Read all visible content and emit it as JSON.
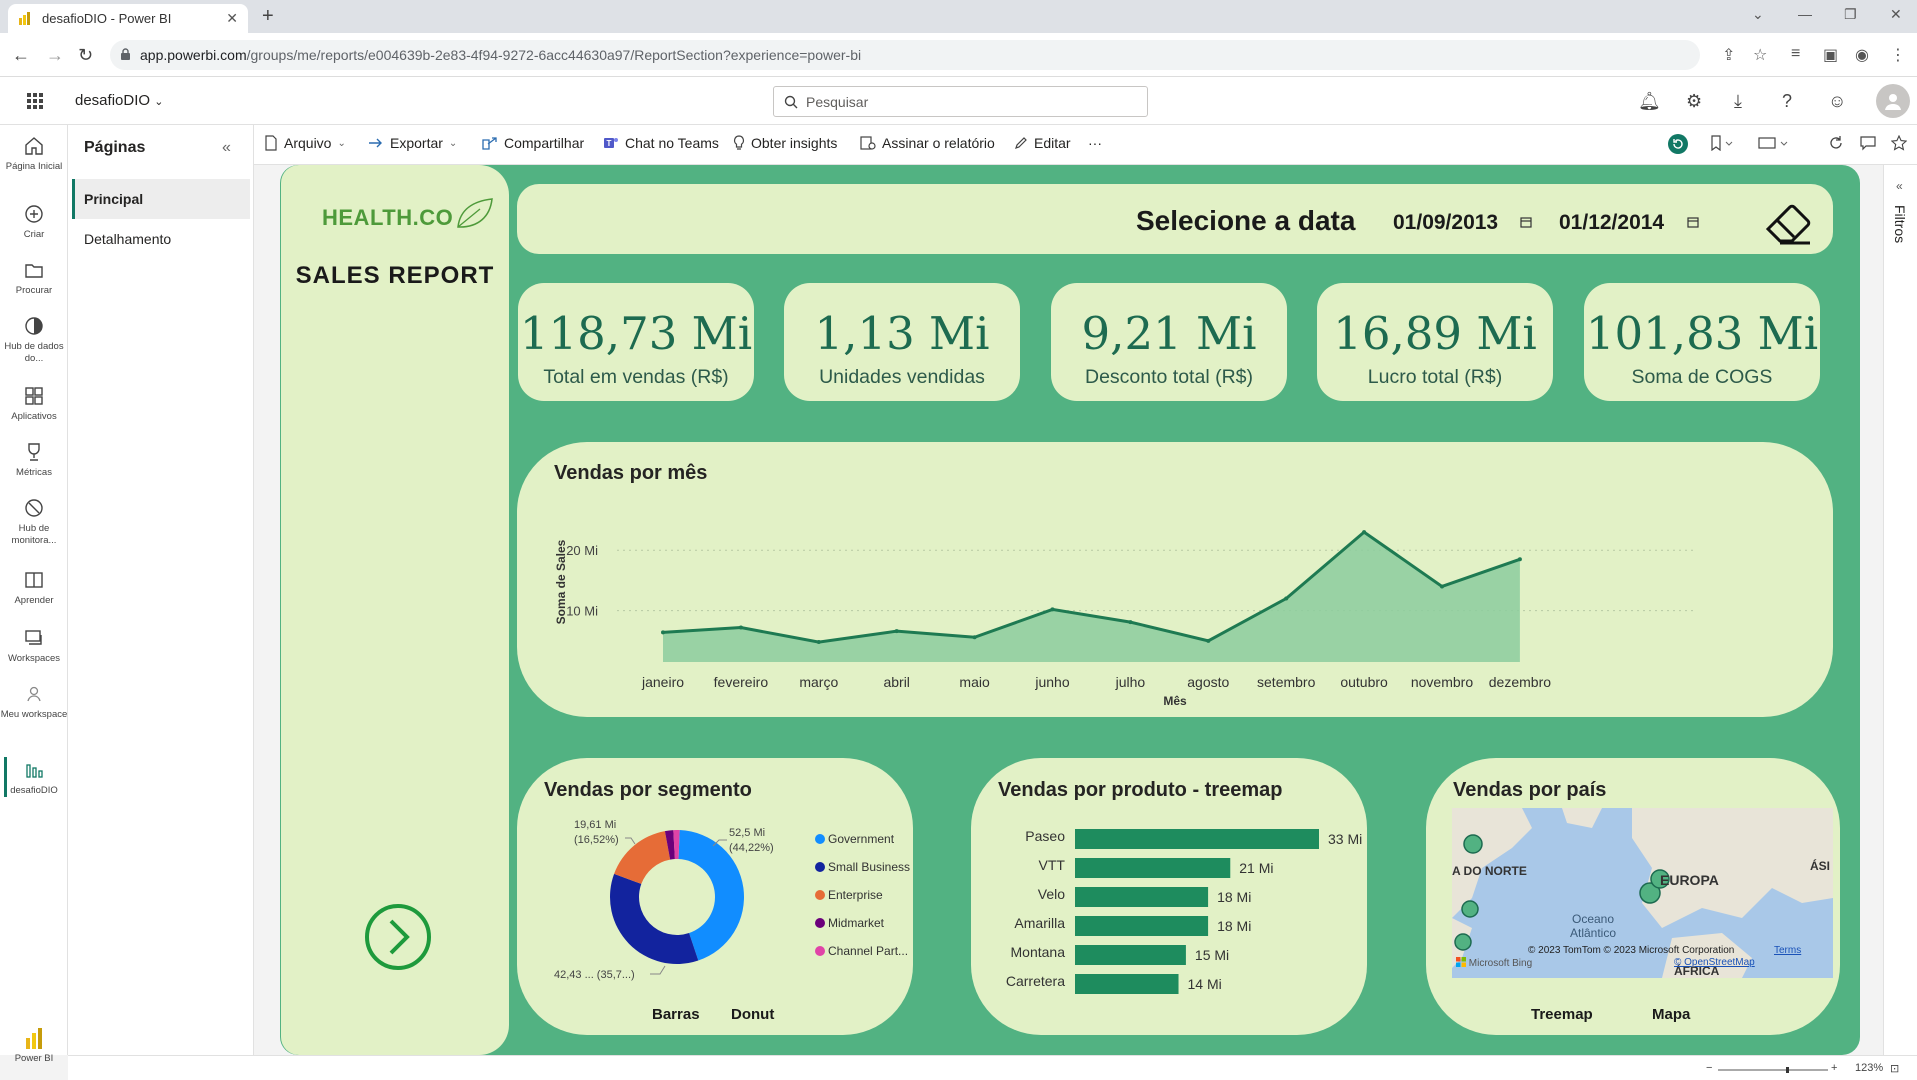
{
  "browser": {
    "tab_title": "desafioDIO - Power BI",
    "url_host": "app.powerbi.com",
    "url_path": "/groups/me/reports/e004639b-2e83-4f94-9272-6acc44630a97/ReportSection?experience=power-bi"
  },
  "topbar": {
    "workspace": "desafioDIO",
    "search_placeholder": "Pesquisar"
  },
  "leftnav": {
    "items": [
      {
        "label": "Página Inicial",
        "icon": "home-icon"
      },
      {
        "label": "Criar",
        "icon": "create-icon"
      },
      {
        "label": "Procurar",
        "icon": "browse-icon"
      },
      {
        "label": "Hub de dados do...",
        "icon": "datahub-icon"
      },
      {
        "label": "Aplicativos",
        "icon": "apps-icon"
      },
      {
        "label": "Métricas",
        "icon": "metrics-icon"
      },
      {
        "label": "Hub de monitora...",
        "icon": "monitoring-icon"
      },
      {
        "label": "Aprender",
        "icon": "learn-icon"
      },
      {
        "label": "Workspaces",
        "icon": "workspaces-icon"
      },
      {
        "label": "Meu workspace",
        "icon": "my-workspace-icon"
      },
      {
        "label": "desafioDIO",
        "icon": "report-icon"
      }
    ],
    "bottom_label": "Power BI"
  },
  "pages_panel": {
    "title": "Páginas",
    "pages": [
      "Principal",
      "Detalhamento"
    ]
  },
  "actions": {
    "arquivo": "Arquivo",
    "exportar": "Exportar",
    "compartilhar": "Compartilhar",
    "chat": "Chat no Teams",
    "insights": "Obter insights",
    "assinar": "Assinar o relatório",
    "editar": "Editar",
    "more": "···"
  },
  "filters_label": "Filtros",
  "report": {
    "brand": "HEALTH.CO",
    "title": "SALES REPORT",
    "date_label": "Selecione a data",
    "date_start": "01/09/2013",
    "date_end": "01/12/2014",
    "kpis": [
      {
        "value": "118,73 Mi",
        "label": "Total em vendas (R$)"
      },
      {
        "value": "1,13 Mi",
        "label": "Unidades vendidas"
      },
      {
        "value": "9,21 Mi",
        "label": "Desconto total (R$)"
      },
      {
        "value": "16,89 Mi",
        "label": "Lucro total (R$)"
      },
      {
        "value": "101,83 Mi",
        "label": "Soma de COGS"
      }
    ],
    "donut_title": "Vendas por segmento",
    "tree_title": "Vendas por produto - treemap",
    "map_title": "Vendas por país",
    "toggle_barras": "Barras",
    "toggle_donut": "Donut",
    "toggle_treemap": "Treemap",
    "toggle_mapa": "Mapa",
    "map_labels": {
      "na": "A DO NORTE",
      "europa": "EUROPA",
      "asia": "ÁSI",
      "ocean": "Oceano Atlântico",
      "africa": "ÁFRICA",
      "copyright": "© 2023 TomTom  © 2023 Microsoft Corporation",
      "terms": "Terms",
      "osm": "© OpenStreetMap",
      "bing": "Microsoft Bing"
    }
  },
  "status": {
    "zoom": "123%"
  },
  "colors": {
    "canvas": "#52b282",
    "card": "#e2f1c6",
    "kpi_text": "#1d6b50",
    "line": "#1e7a52",
    "area": "#8ccc9e",
    "bar": "#1e8c5e"
  },
  "chart_data": [
    {
      "type": "area",
      "title": "Vendas por mês",
      "xlabel": "Mês",
      "ylabel": "Soma de Sales",
      "categories": [
        "janeiro",
        "fevereiro",
        "março",
        "abril",
        "maio",
        "junho",
        "julho",
        "agosto",
        "setembro",
        "outubro",
        "novembro",
        "dezembro"
      ],
      "values": [
        6.4,
        7.2,
        4.8,
        6.6,
        5.6,
        10.2,
        8.1,
        5.0,
        12.0,
        23.0,
        14.0,
        18.5
      ],
      "yticks": [
        "10 Mi",
        "20 Mi"
      ],
      "ytick_values": [
        10,
        20
      ],
      "ylim": [
        1.5,
        25
      ],
      "grid": true
    },
    {
      "type": "pie",
      "title": "Vendas por segmento",
      "categories": [
        "Government",
        "Small Business",
        "Enterprise",
        "Midmarket",
        "Channel Part..."
      ],
      "values": [
        52.5,
        42.43,
        19.61,
        2.38,
        1.8
      ],
      "colors": [
        "#118dff",
        "#12239e",
        "#e66c37",
        "#6b007b",
        "#e044a7"
      ],
      "data_labels": [
        {
          "value": "52,5 Mi",
          "pct": "(44,22%)"
        },
        {
          "value": "42,43 ... (35,7...)",
          "pct": ""
        },
        {
          "value": "19,61 Mi",
          "pct": "(16,52%)"
        }
      ]
    },
    {
      "type": "bar",
      "title": "Vendas por produto - treemap",
      "categories": [
        "Paseo",
        "VTT",
        "Velo",
        "Amarilla",
        "Montana",
        "Carretera"
      ],
      "values": [
        33,
        21,
        18,
        18,
        15,
        14
      ],
      "labels": [
        "33 Mi",
        "21 Mi",
        "18 Mi",
        "18 Mi",
        "15 Mi",
        "14 Mi"
      ]
    }
  ]
}
